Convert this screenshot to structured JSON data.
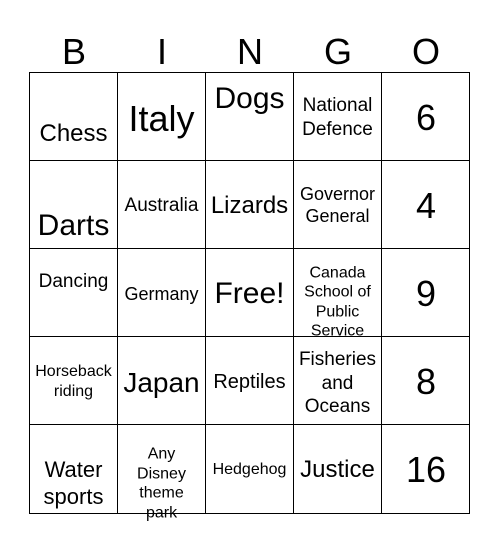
{
  "header": [
    "B",
    "I",
    "N",
    "G",
    "O"
  ],
  "cells": [
    [
      "Chess",
      "Italy",
      "Dogs",
      "National\nDefence",
      "6"
    ],
    [
      "Darts",
      "Australia",
      "Lizards",
      "Governor\nGeneral",
      "4"
    ],
    [
      "Dancing",
      "Germany",
      "Free!",
      "Canada\nSchool of\nPublic\nService",
      "9"
    ],
    [
      "Horseback\nriding",
      "Japan",
      "Reptiles",
      "Fisheries\nand\nOceans",
      "8"
    ],
    [
      "Water\nsports",
      "Any\nDisney\ntheme\npark",
      "Hedgehog",
      "Justice",
      "16"
    ]
  ]
}
